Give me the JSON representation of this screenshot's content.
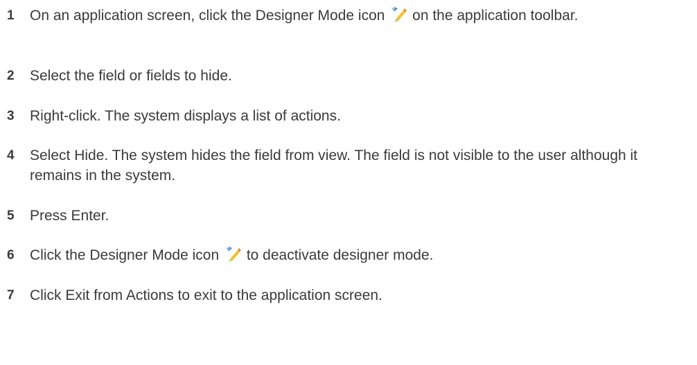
{
  "steps": [
    {
      "number": "1",
      "text_before": "On an application screen, click the Designer Mode icon",
      "icon": "designer-mode-icon",
      "text_after": "on the application toolbar."
    },
    {
      "number": "2",
      "text": "Select the field or fields to hide."
    },
    {
      "number": "3",
      "text": "Right-click. The system displays a list of actions."
    },
    {
      "number": "4",
      "text": "Select Hide. The system hides the field from view. The field is not visible to the user although it remains in the system."
    },
    {
      "number": "5",
      "text": "Press Enter."
    },
    {
      "number": "6",
      "text_before": "Click the Designer Mode icon",
      "icon": "designer-mode-icon",
      "text_after": "to deactivate designer mode."
    },
    {
      "number": "7",
      "text": "Click Exit from Actions to exit to the application screen."
    }
  ]
}
